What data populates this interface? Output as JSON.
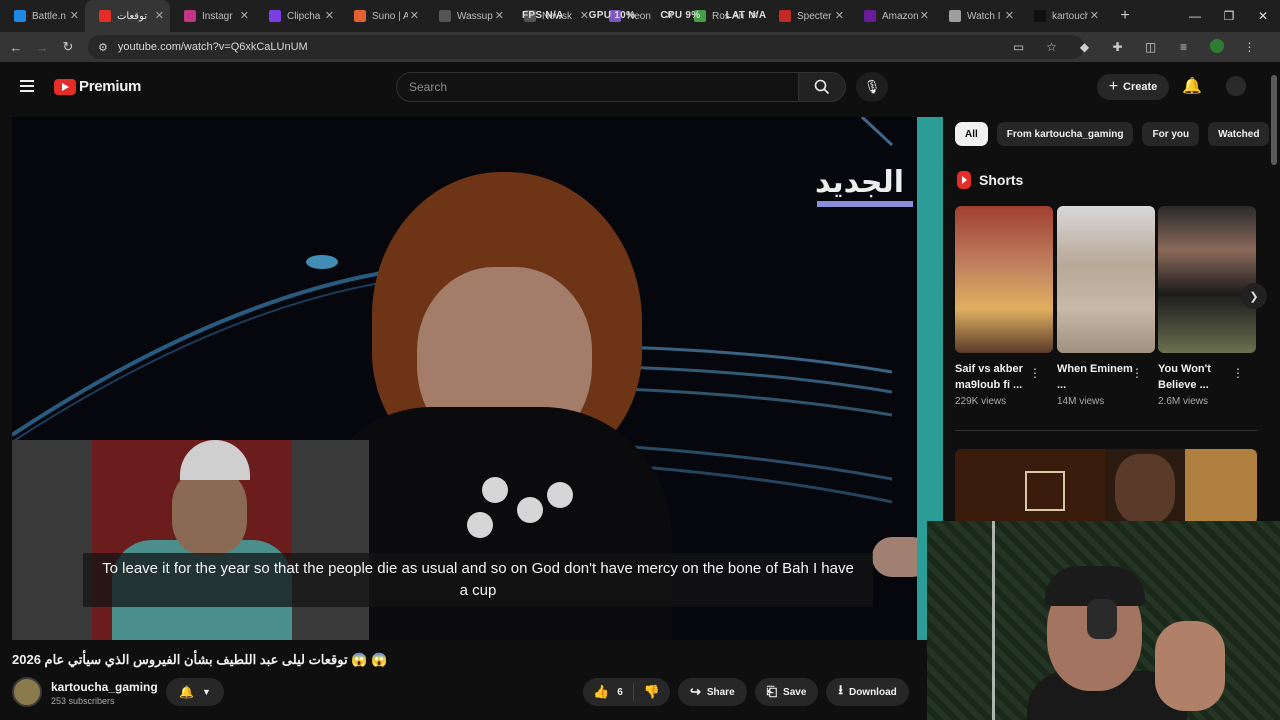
{
  "browser": {
    "tabs": [
      {
        "label": "Battle.n",
        "color": "#1e88e5",
        "icon": "battlenet-icon"
      },
      {
        "label": "توقعات",
        "color": "#e52d27",
        "icon": "youtube-icon",
        "active": true
      },
      {
        "label": "Instagr",
        "color": "#c13584",
        "icon": "instagram-icon"
      },
      {
        "label": "Clipcha",
        "color": "#7b3fe4",
        "icon": "clipchamp-icon"
      },
      {
        "label": "Suno | A",
        "color": "#e06030",
        "icon": "suno-icon"
      },
      {
        "label": "Wassup",
        "color": "#555555",
        "icon": "openai-icon"
      },
      {
        "label": "Newsk",
        "color": "#555555",
        "icon": "globe-icon"
      },
      {
        "label": "Neon",
        "color": "#7e57c2",
        "icon": "s-icon"
      },
      {
        "label": "Ros An",
        "color": "#43a047",
        "icon": "tab-icon"
      },
      {
        "label": "Specter",
        "color": "#c62828",
        "icon": "specter-icon"
      },
      {
        "label": "Amazon",
        "color": "#6a1b9a",
        "icon": "amazon-icon"
      },
      {
        "label": "Watch I",
        "color": "#9e9e9e",
        "icon": "watch-icon"
      },
      {
        "label": "kartouch",
        "color": "#111111",
        "icon": "tiktok-icon"
      }
    ],
    "new_tab": "+",
    "stats": {
      "fps": "FPS N/A",
      "gpu": "GPU 10%",
      "cpu": "CPU 9%",
      "lat": "LAT N/A"
    },
    "url": "youtube.com/watch?v=Q6xkCaLUnUM",
    "window": {
      "minimize": "—",
      "restore": "❐",
      "close": "✕"
    }
  },
  "youtube": {
    "logo_text": "Premium",
    "search_placeholder": "Search",
    "create_label": "Create",
    "video": {
      "channel_watermark": "الجديد",
      "subtitle": "To leave it for the year so that the people die as usual and so on God don't have mercy on the bone of Bah I have a cup",
      "title": "2026 توقعات ليلى عبد اللطيف بشأن الفيروس الذي سيأتي عام 😱 😱",
      "channel": "kartoucha_gaming",
      "subscribers": "253 subscribers",
      "likes": "6",
      "share": "Share",
      "save": "Save",
      "download": "Download"
    },
    "chips": [
      "All",
      "From kartoucha_gaming",
      "For you",
      "Watched"
    ],
    "shorts_title": "Shorts",
    "shorts": [
      {
        "title": "Saif vs akber ma9loub fi ...",
        "views": "229K views"
      },
      {
        "title": "When Eminem ...",
        "views": "14M views"
      },
      {
        "title": "You Won't Believe ...",
        "views": "2.6M views"
      }
    ]
  }
}
